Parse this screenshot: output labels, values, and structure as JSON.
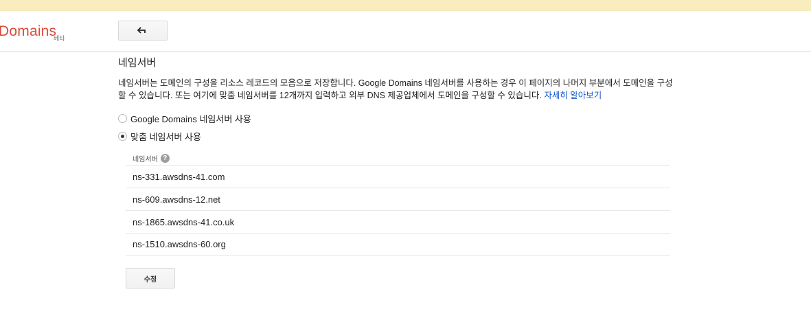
{
  "header": {
    "logo_text": "Domains",
    "beta_label": "베타",
    "back_icon": "back-arrow-icon"
  },
  "main": {
    "title": "네임서버",
    "description_line1": "네임서버는 도메인의 구성을 리소스 레코드의 모음으로 저장합니다. Google Domains 네임서버를 사용하는 경우 이 페이지의 나머지 부분에서 도메인을 구성",
    "description_line2": "할 수 있습니다. 또는 여기에 맞춤 네임서버를 12개까지 입력하고 외부 DNS 제공업체에서 도메인을 구성할 수 있습니다.",
    "learn_more": "자세히 알아보기",
    "options": [
      {
        "label": "Google Domains 네임서버 사용",
        "selected": false
      },
      {
        "label": "맞춤 네임서버 사용",
        "selected": true
      }
    ],
    "nameservers_header": "네임서버",
    "help_glyph": "?",
    "nameservers": [
      "ns-331.awsdns-41.com",
      "ns-609.awsdns-12.net",
      "ns-1865.awsdns-41.co.uk",
      "ns-1510.awsdns-60.org"
    ],
    "edit_label": "수정"
  },
  "colors": {
    "banner": "#f9edbe",
    "logo": "#dd4b39",
    "link": "#1155cc"
  }
}
